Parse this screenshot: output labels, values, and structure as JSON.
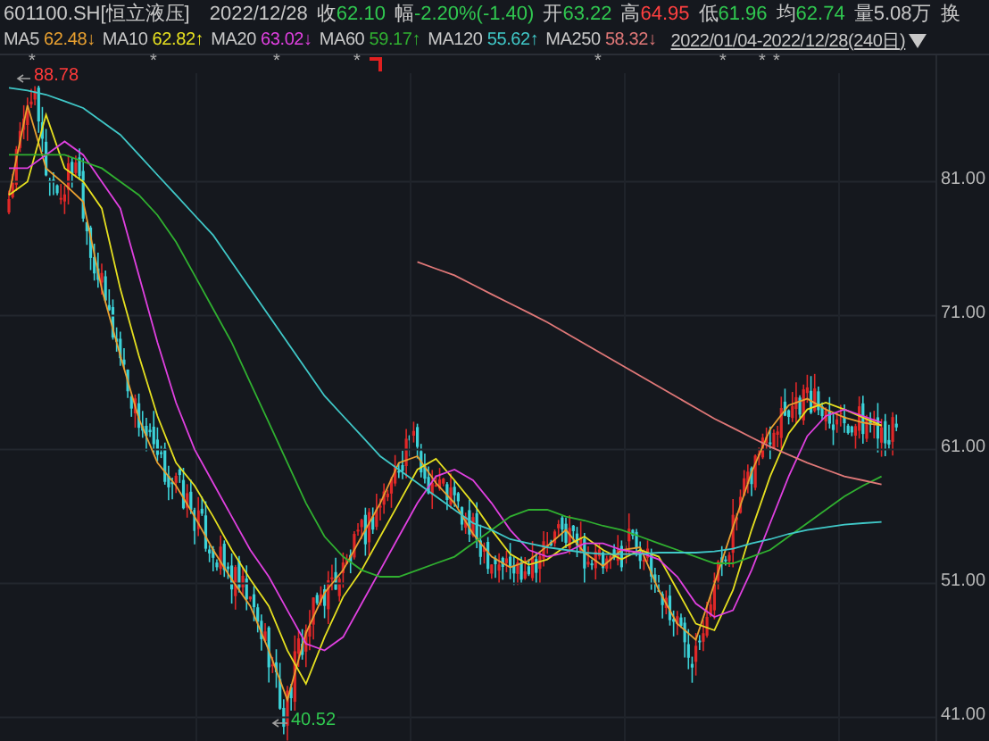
{
  "header": {
    "symbol": "601100.SH[恒立液压]",
    "date": "2022/12/28",
    "quotes": [
      {
        "label": "收",
        "value": "62.10",
        "color": "#30c850"
      },
      {
        "label": "幅",
        "value": "-2.20%(-1.40)",
        "color": "#30c850"
      },
      {
        "label": "开",
        "value": "63.22",
        "color": "#30c850"
      },
      {
        "label": "高",
        "value": "64.95",
        "color": "#ff4040"
      },
      {
        "label": "低",
        "value": "61.96",
        "color": "#30c850"
      },
      {
        "label": "均",
        "value": "62.74",
        "color": "#30c850"
      },
      {
        "label": "量",
        "value": "5.08万",
        "color": "#c8c8c8"
      },
      {
        "label": "换"
      }
    ]
  },
  "moving_averages": [
    {
      "value": "62.48",
      "arrow": "↓"
    },
    {
      "value": "62.82",
      "arrow": "↑"
    },
    {
      "value": "63.02",
      "arrow": "↓"
    },
    {
      "value": "59.17",
      "arrow": "↑"
    },
    {
      "value": "55.62",
      "arrow": "↑"
    },
    {
      "value": "58.32",
      "arrow": "↓"
    }
  ],
  "range": "2022/01/04-2022/12/28(240日)",
  "chart": {
    "markers": [
      "*",
      "*",
      "*",
      "*",
      "*",
      "*",
      "*",
      "*"
    ],
    "high_label": "88.78",
    "low_label": "40.52",
    "chart_data": {
      "type": "line",
      "grid": true,
      "ylim": [
        39.1,
        89.1
      ],
      "yticks": [
        {
          "value": 81,
          "label": "81.00"
        },
        {
          "value": 71,
          "label": "71.00"
        },
        {
          "value": 61,
          "label": "61.00"
        },
        {
          "value": 51,
          "label": "51.00"
        },
        {
          "value": 41,
          "label": "41.00"
        }
      ],
      "series": [
        {
          "name": "MA5",
          "color": "#e8a030",
          "values": [
            80,
            86.7,
            82,
            80.8,
            79.5,
            73,
            68,
            63.3,
            60,
            58.3,
            56,
            53.5,
            51.3,
            49.3,
            46,
            42.3,
            47.3,
            50.3,
            52,
            54.5,
            57,
            60,
            60.5,
            58.5,
            57,
            54.7,
            53,
            52.2,
            52.7,
            53.8,
            55,
            53.3,
            52.3,
            53.5,
            53.7,
            50.5,
            48,
            46.8,
            51,
            55.2,
            59.3,
            62.5,
            64.3,
            64.8,
            64,
            63.4,
            63,
            62.8
          ]
        },
        {
          "name": "MA10",
          "color": "#e6e020",
          "values": [
            80,
            81,
            86,
            82,
            81,
            79,
            73,
            68,
            63.5,
            60,
            58.3,
            56,
            53.5,
            51.3,
            49.3,
            46,
            43.5,
            47,
            50,
            52,
            54.5,
            57,
            59.5,
            60.3,
            58.7,
            57,
            55,
            53.2,
            52.4,
            52.8,
            53.8,
            54.5,
            53.5,
            52.8,
            53.5,
            53,
            50.5,
            48,
            47.5,
            50.5,
            55,
            59,
            62.2,
            64,
            64.5,
            64,
            63.4,
            62.8
          ]
        },
        {
          "name": "MA20",
          "color": "#e040e0",
          "values": [
            82,
            82,
            83,
            84,
            83,
            81,
            79,
            74,
            69,
            64.5,
            61,
            58.5,
            56,
            53.5,
            51.5,
            49,
            46.5,
            46,
            47,
            49.5,
            52,
            54.5,
            57,
            59,
            59.5,
            58.7,
            57,
            55,
            53.5,
            53,
            53.3,
            54,
            54,
            53.5,
            53.3,
            52.8,
            51.5,
            49.5,
            48.5,
            49,
            52,
            55.5,
            59,
            62,
            63.5,
            64,
            63.5,
            63
          ]
        },
        {
          "name": "MA60",
          "color": "#30b030",
          "values": [
            83,
            83,
            83,
            83,
            82.5,
            82,
            81,
            80,
            78.5,
            76.5,
            74,
            71.5,
            69,
            66,
            63,
            60,
            57,
            54.5,
            53,
            52,
            51.5,
            51.5,
            52,
            52.5,
            53,
            54,
            55,
            56,
            56.5,
            56.5,
            56,
            55.7,
            55.3,
            55,
            54.5,
            54,
            53.5,
            53,
            52.5,
            52.5,
            53,
            53.5,
            54.5,
            55.5,
            56.5,
            57.5,
            58.3,
            59
          ]
        },
        {
          "name": "MA120",
          "color": "#40c8c8",
          "values": [
            88,
            87.8,
            87.5,
            87,
            86.5,
            85.5,
            84.5,
            83,
            81.5,
            80,
            78.5,
            77,
            75,
            73,
            71,
            69,
            67,
            65,
            63.5,
            62,
            60.5,
            59.5,
            58.5,
            57.5,
            56.5,
            55.5,
            55,
            54.3,
            54,
            53.7,
            53.5,
            53.3,
            53.2,
            53.2,
            53.2,
            53.3,
            53.3,
            53.3,
            53.4,
            53.6,
            54,
            54.3,
            54.7,
            55,
            55.2,
            55.4,
            55.5,
            55.6
          ]
        },
        {
          "name": "MA250",
          "color": "#e07878",
          "values": [
            null,
            null,
            null,
            null,
            null,
            null,
            null,
            null,
            null,
            null,
            null,
            null,
            null,
            null,
            null,
            null,
            null,
            null,
            null,
            null,
            null,
            null,
            75,
            74.5,
            74,
            73.3,
            72.6,
            71.9,
            71.2,
            70.5,
            69.7,
            68.9,
            68.1,
            67.3,
            66.5,
            65.7,
            64.9,
            64.1,
            63.3,
            62.6,
            61.9,
            61.2,
            60.6,
            60,
            59.5,
            59,
            58.7,
            58.4
          ]
        }
      ]
    }
  }
}
